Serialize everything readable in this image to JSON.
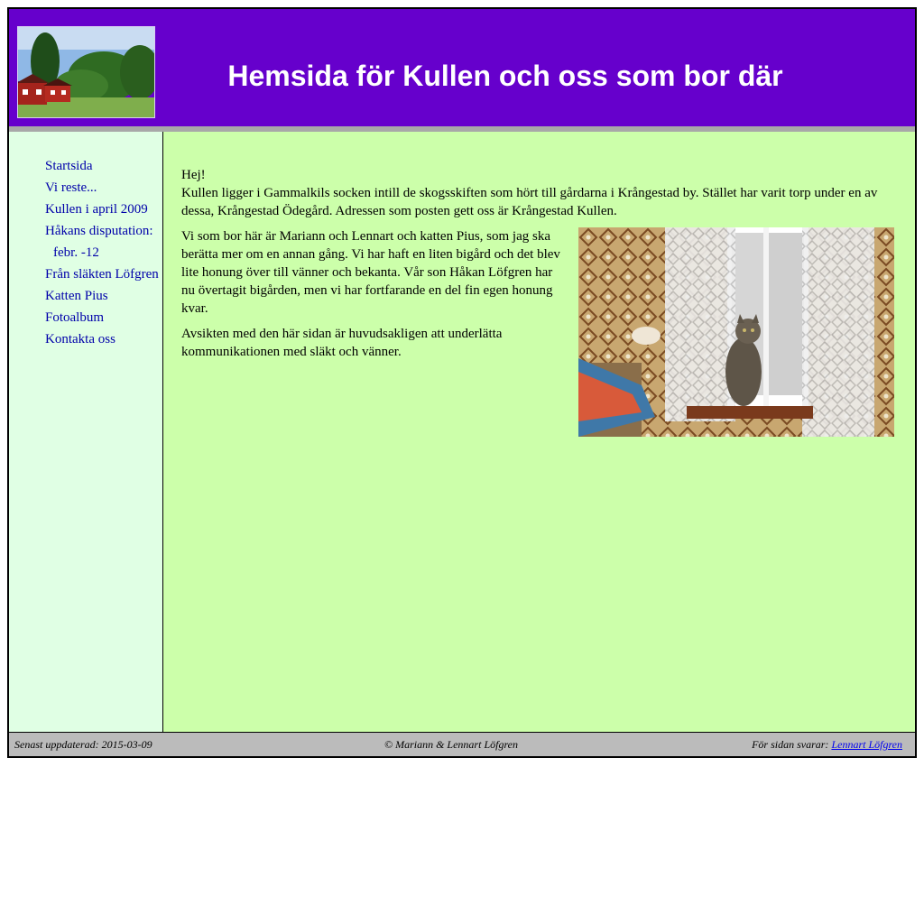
{
  "header": {
    "title": "Hemsida för Kullen och oss som bor där",
    "background_color": "#6600cc",
    "logo_icon": "farmhouse-photo"
  },
  "sidebar": {
    "background_color": "#e0ffe4",
    "items": [
      {
        "label": "Startsida"
      },
      {
        "label": "Vi reste..."
      },
      {
        "label": "Kullen i april 2009"
      },
      {
        "label": "Håkans disputation:"
      },
      {
        "label": "febr. -12"
      },
      {
        "label": "Från släkten Löfgren"
      },
      {
        "label": "Katten Pius"
      },
      {
        "label": "Fotoalbum"
      },
      {
        "label": "Kontakta oss"
      }
    ]
  },
  "main": {
    "background_color": "#ccffaa",
    "greeting": "Hej!",
    "intro": "Kullen ligger i Gammalkils socken intill de skogsskiften som hört till gårdarna i Krångestad by. Stället har varit torp under en av dessa, Krångestad Ödegård. Adressen som posten gett oss är Krångestad Kullen.",
    "paragraph_2": "Vi som bor här är Mariann och Lennart och katten Pius, som jag ska berätta mer om en annan gång. Vi har haft en liten bigård och det blev lite honung över till vänner och bekanta. Vår son Håkan Löfgren har nu övertagit bigården, men vi har fortfarande en del fin egen honung kvar.",
    "paragraph_3": "Avsikten med den här sidan är huvudsakligen att underlätta kommunikationen med släkt och vänner.",
    "photo_icon": "cat-in-window-photo"
  },
  "footer": {
    "updated": "Senast uppdaterad: 2015-03-09",
    "copyright": "© Mariann & Lennart Löfgren",
    "responsible_prefix": "För sidan svarar:",
    "responsible_link": "Lennart Löfgren"
  }
}
